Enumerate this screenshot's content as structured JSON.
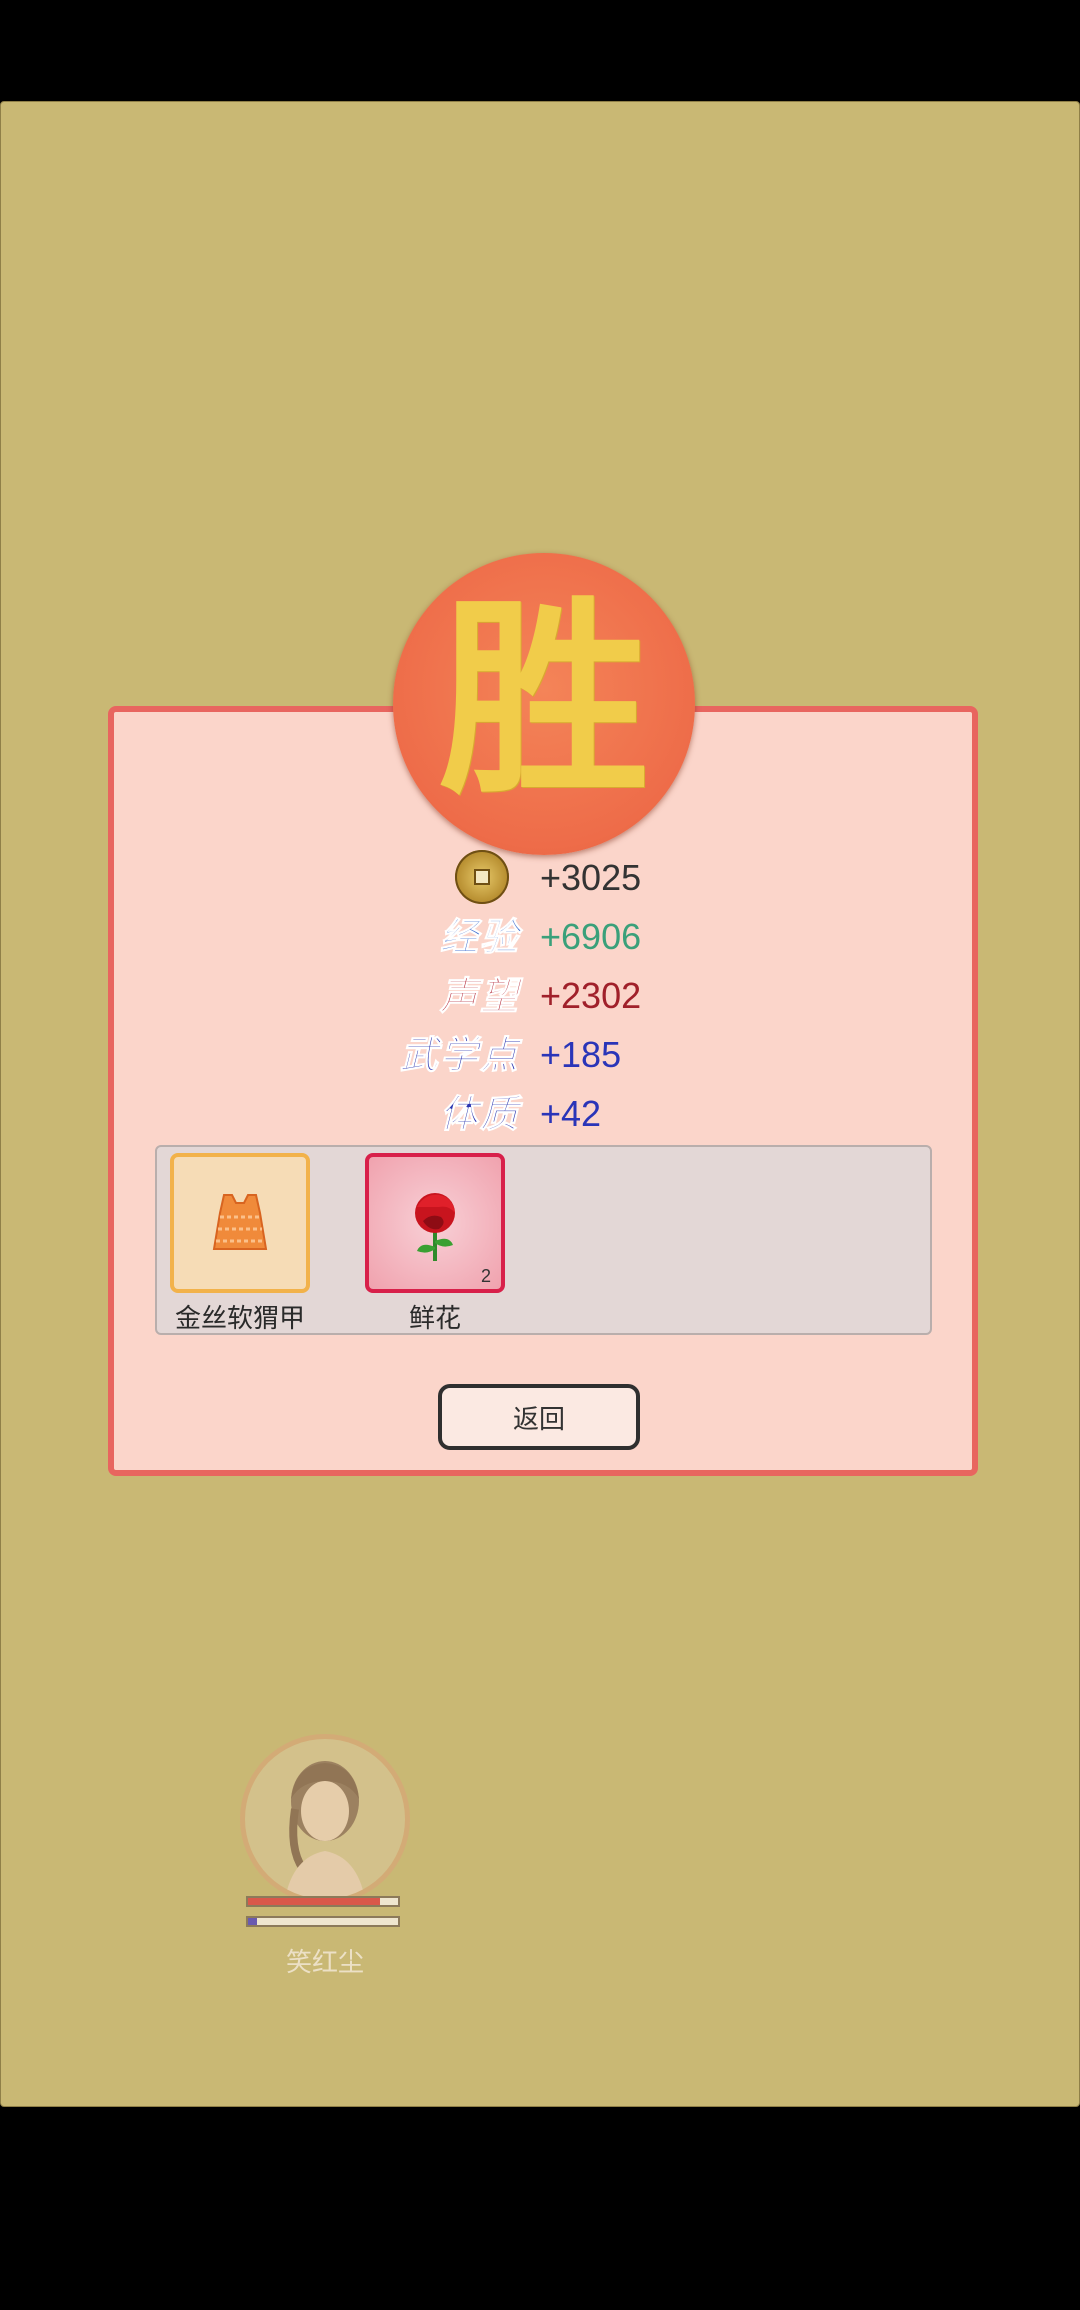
{
  "victory": {
    "char": "胜"
  },
  "rewards": [
    {
      "label": "",
      "value": "+3025",
      "icon": "copper-coin-icon",
      "label_color": "#2e4aa8",
      "value_color": "#333333"
    },
    {
      "label": "经验",
      "value": "+6906",
      "label_color": "#3f6fd0",
      "value_color": "#3aa07a"
    },
    {
      "label": "声望",
      "value": "+2302",
      "label_color": "#b02030",
      "value_color": "#a0202a"
    },
    {
      "label": "武学点",
      "value": "+185",
      "label_color": "#2a35b0",
      "value_color": "#2a35b8"
    },
    {
      "label": "体质",
      "value": "+42",
      "label_color": "#2a35b0",
      "value_color": "#2a35b8"
    }
  ],
  "items": [
    {
      "name": "金丝软猬甲",
      "icon": "golden-vest-icon",
      "count": "",
      "border": "#f2b24a",
      "bg": "#f6dcb6"
    },
    {
      "name": "鲜花",
      "icon": "red-rose-icon",
      "count": "2",
      "border": "#d8204a",
      "bg": "#f4b4bc"
    }
  ],
  "back_button": {
    "label": "返回"
  },
  "player": {
    "name": "笑红尘",
    "hp_fraction": 0.88,
    "mp_fraction": 0.06
  }
}
